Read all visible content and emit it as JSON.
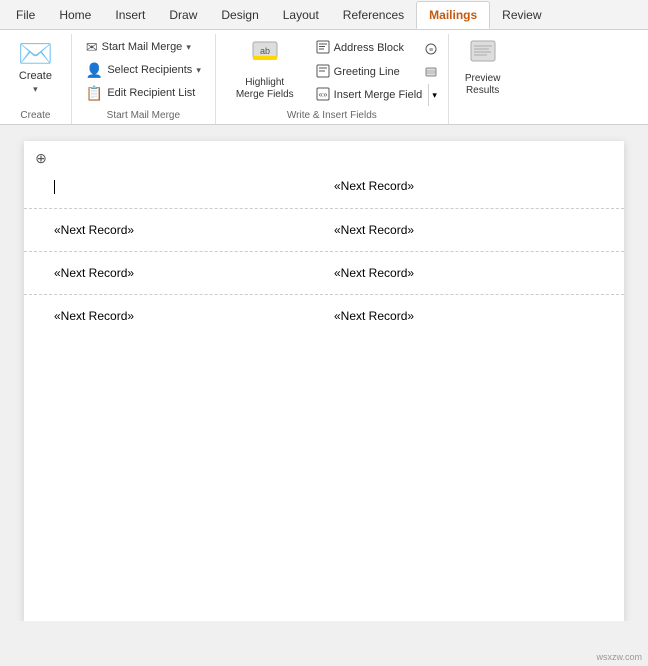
{
  "tabs": [
    {
      "id": "file",
      "label": "File",
      "active": false
    },
    {
      "id": "home",
      "label": "Home",
      "active": false
    },
    {
      "id": "insert",
      "label": "Insert",
      "active": false
    },
    {
      "id": "draw",
      "label": "Draw",
      "active": false
    },
    {
      "id": "design",
      "label": "Design",
      "active": false
    },
    {
      "id": "layout",
      "label": "Layout",
      "active": false
    },
    {
      "id": "references",
      "label": "References",
      "active": false
    },
    {
      "id": "mailings",
      "label": "Mailings",
      "active": true
    },
    {
      "id": "review",
      "label": "Review",
      "active": false
    }
  ],
  "ribbon": {
    "groups": [
      {
        "id": "create",
        "label": "Create",
        "buttons_large": [
          {
            "id": "create-btn",
            "label": "Create",
            "icon": "📄",
            "has_chevron": true
          }
        ],
        "buttons_small": []
      },
      {
        "id": "start-mail-merge",
        "label": "Start Mail Merge",
        "buttons_small": [
          {
            "id": "start-mail-merge-btn",
            "label": "Start Mail Merge",
            "icon": "✉",
            "has_chevron": true
          },
          {
            "id": "select-recipients-btn",
            "label": "Select Recipients",
            "icon": "👤",
            "has_chevron": true
          },
          {
            "id": "edit-recipient-list-btn",
            "label": "Edit Recipient List",
            "icon": "📋",
            "has_chevron": false
          }
        ]
      },
      {
        "id": "highlight-merge-fields",
        "label": "Write & Insert Fields",
        "highlight_btn": {
          "id": "highlight-btn",
          "label": "Highlight\nMerge Fields",
          "icon": "🖊"
        },
        "buttons_small": [
          {
            "id": "address-block-btn",
            "label": "Address Block",
            "icon": "📧",
            "has_chevron": false
          },
          {
            "id": "greeting-line-btn",
            "label": "Greeting Line",
            "icon": "📄",
            "has_chevron": false
          },
          {
            "id": "insert-merge-field-btn",
            "label": "Insert Merge Field",
            "icon": "📄",
            "has_chevron": true
          }
        ],
        "extra_icons": [
          {
            "id": "extra-icon-1",
            "icon": "⚡"
          },
          {
            "id": "extra-icon-2",
            "icon": "⚡"
          }
        ]
      },
      {
        "id": "preview-results",
        "label": "Preview\nResults",
        "preview_btn": {
          "id": "preview-btn",
          "label": "Preview\nResults",
          "icon": "👁"
        }
      }
    ]
  },
  "document": {
    "sections": [
      {
        "left_content": null,
        "right_content": "«Next Record»",
        "has_cursor_left": true
      },
      {
        "left_content": "«Next Record»",
        "right_content": "«Next Record»"
      },
      {
        "left_content": "«Next Record»",
        "right_content": "«Next Record»"
      },
      {
        "left_content": "«Next Record»",
        "right_content": "«Next Record»"
      }
    ]
  },
  "watermark": "wsxzw.com"
}
